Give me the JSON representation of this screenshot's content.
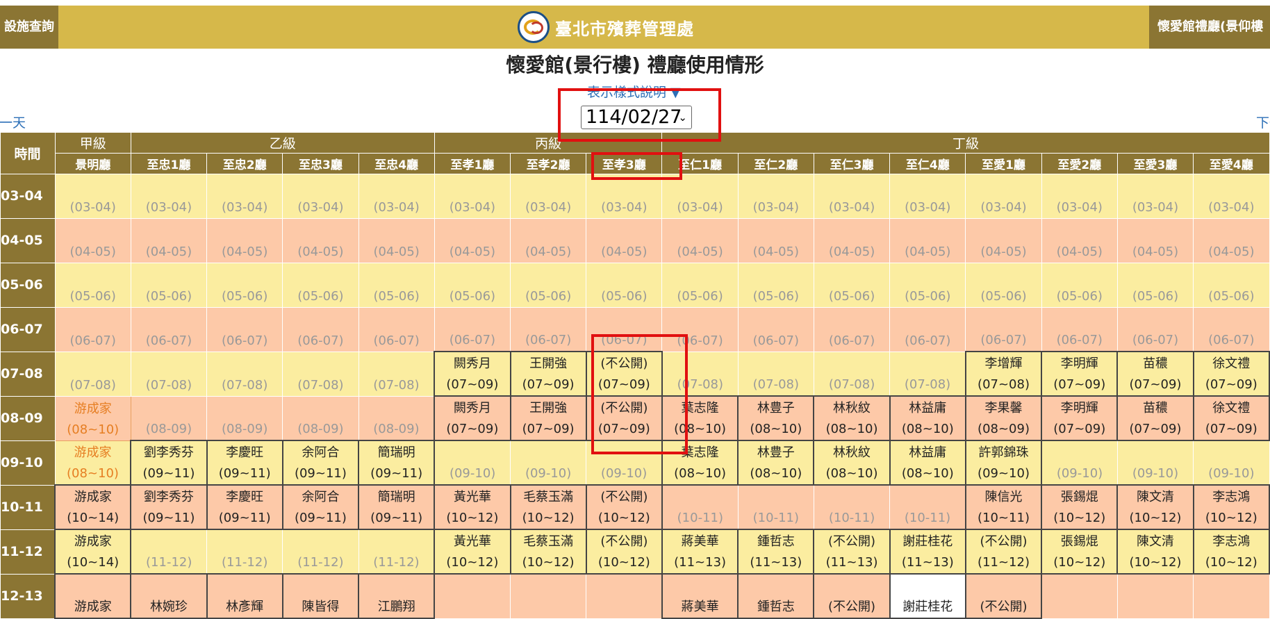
{
  "header": {
    "left_button": "設施查詢",
    "brand_title": "臺北市殯葬管理處",
    "right_button": "懷愛館禮廳(景仰樓"
  },
  "page_title": "懷愛館(景行樓) 禮廳使用情形",
  "legend_link": "表示樣式說明 ▼",
  "date_select": {
    "value": "114/02/27"
  },
  "nav": {
    "prev": "上一天",
    "next": "下一"
  },
  "time_header": "時間",
  "groups": [
    {
      "label": "甲級",
      "span": 1
    },
    {
      "label": "乙級",
      "span": 4
    },
    {
      "label": "丙級",
      "span": 3
    },
    {
      "label": "丁級",
      "span": 8
    }
  ],
  "halls": [
    "景明廳",
    "至忠1廳",
    "至忠2廳",
    "至忠3廳",
    "至忠4廳",
    "至孝1廳",
    "至孝2廳",
    "至孝3廳",
    "至仁1廳",
    "至仁2廳",
    "至仁3廳",
    "至仁4廳",
    "至愛1廳",
    "至愛2廳",
    "至愛3廳",
    "至愛4廳"
  ],
  "rows": [
    {
      "time": "03-04",
      "tone": "y",
      "cells": [
        {
          "t": "(03-04)"
        },
        {
          "t": "(03-04)"
        },
        {
          "t": "(03-04)"
        },
        {
          "t": "(03-04)"
        },
        {
          "t": "(03-04)"
        },
        {
          "t": "(03-04)"
        },
        {
          "t": "(03-04)"
        },
        {
          "t": "(03-04)"
        },
        {
          "t": "(03-04)"
        },
        {
          "t": "(03-04)"
        },
        {
          "t": "(03-04)"
        },
        {
          "t": "(03-04)"
        },
        {
          "t": "(03-04)"
        },
        {
          "t": "(03-04)"
        },
        {
          "t": "(03-04)"
        },
        {
          "t": "(03-04)"
        }
      ]
    },
    {
      "time": "04-05",
      "tone": "p",
      "cells": [
        {
          "t": "(04-05)"
        },
        {
          "t": "(04-05)"
        },
        {
          "t": "(04-05)"
        },
        {
          "t": "(04-05)"
        },
        {
          "t": "(04-05)"
        },
        {
          "t": "(04-05)"
        },
        {
          "t": "(04-05)"
        },
        {
          "t": "(04-05)"
        },
        {
          "t": "(04-05)"
        },
        {
          "t": "(04-05)"
        },
        {
          "t": "(04-05)"
        },
        {
          "t": "(04-05)"
        },
        {
          "t": "(04-05)"
        },
        {
          "t": "(04-05)"
        },
        {
          "t": "(04-05)"
        },
        {
          "t": "(04-05)"
        }
      ]
    },
    {
      "time": "05-06",
      "tone": "y",
      "cells": [
        {
          "t": "(05-06)"
        },
        {
          "t": "(05-06)"
        },
        {
          "t": "(05-06)"
        },
        {
          "t": "(05-06)"
        },
        {
          "t": "(05-06)"
        },
        {
          "t": "(05-06)"
        },
        {
          "t": "(05-06)"
        },
        {
          "t": "(05-06)"
        },
        {
          "t": "(05-06)"
        },
        {
          "t": "(05-06)"
        },
        {
          "t": "(05-06)"
        },
        {
          "t": "(05-06)"
        },
        {
          "t": "(05-06)"
        },
        {
          "t": "(05-06)"
        },
        {
          "t": "(05-06)"
        },
        {
          "t": "(05-06)"
        }
      ]
    },
    {
      "time": "06-07",
      "tone": "p",
      "cells": [
        {
          "t": "(06-07)"
        },
        {
          "t": "(06-07)"
        },
        {
          "t": "(06-07)"
        },
        {
          "t": "(06-07)"
        },
        {
          "t": "(06-07)"
        },
        {
          "t": "(06-07)"
        },
        {
          "t": "(06-07)"
        },
        {
          "t": "(06-07)"
        },
        {
          "t": "(06-07)"
        },
        {
          "t": "(06-07)"
        },
        {
          "t": "(06-07)"
        },
        {
          "t": "(06-07)"
        },
        {
          "t": "(06-07)"
        },
        {
          "t": "(06-07)"
        },
        {
          "t": "(06-07)"
        },
        {
          "t": "(06-07)"
        }
      ]
    },
    {
      "time": "07-08",
      "tone": "y",
      "cells": [
        {
          "t": "(07-08)"
        },
        {
          "t": "(07-08)"
        },
        {
          "t": "(07-08)"
        },
        {
          "t": "(07-08)"
        },
        {
          "t": "(07-08)"
        },
        {
          "n": "闕秀月",
          "t": "(07~09)"
        },
        {
          "n": "王開強",
          "t": "(07~09)"
        },
        {
          "n": "(不公開)",
          "t": "(07~09)"
        },
        {
          "t": "(07-08)"
        },
        {
          "t": "(07-08)"
        },
        {
          "t": "(07-08)"
        },
        {
          "t": "(07-08)"
        },
        {
          "n": "李增輝",
          "t": "(07~08)"
        },
        {
          "n": "李明輝",
          "t": "(07~09)"
        },
        {
          "n": "苗穠",
          "t": "(07~09)"
        },
        {
          "n": "徐文禮",
          "t": "(07~09)"
        }
      ]
    },
    {
      "time": "08-09",
      "tone": "p",
      "cells": [
        {
          "n": "游成家",
          "t": "(08~10)",
          "orange": true
        },
        {
          "t": "(08-09)"
        },
        {
          "t": "(08-09)"
        },
        {
          "t": "(08-09)"
        },
        {
          "t": "(08-09)"
        },
        {
          "n": "闕秀月",
          "t": "(07~09)"
        },
        {
          "n": "王開強",
          "t": "(07~09)"
        },
        {
          "n": "(不公開)",
          "t": "(07~09)"
        },
        {
          "n": "葉志隆",
          "t": "(08~10)"
        },
        {
          "n": "林豊子",
          "t": "(08~10)"
        },
        {
          "n": "林秋紋",
          "t": "(08~10)"
        },
        {
          "n": "林益庸",
          "t": "(08~10)"
        },
        {
          "n": "李果馨",
          "t": "(08~09)"
        },
        {
          "n": "李明輝",
          "t": "(07~09)"
        },
        {
          "n": "苗穠",
          "t": "(07~09)"
        },
        {
          "n": "徐文禮",
          "t": "(07~09)"
        }
      ]
    },
    {
      "time": "09-10",
      "tone": "y",
      "cells": [
        {
          "n": "游成家",
          "t": "(08~10)",
          "orange": true
        },
        {
          "n": "劉李秀芬",
          "t": "(09~11)"
        },
        {
          "n": "李慶旺",
          "t": "(09~11)"
        },
        {
          "n": "余阿合",
          "t": "(09~11)"
        },
        {
          "n": "簡瑞明",
          "t": "(09~11)"
        },
        {
          "t": "(09-10)"
        },
        {
          "t": "(09-10)"
        },
        {
          "t": "(09-10)"
        },
        {
          "n": "葉志隆",
          "t": "(08~10)"
        },
        {
          "n": "林豊子",
          "t": "(08~10)"
        },
        {
          "n": "林秋紋",
          "t": "(08~10)"
        },
        {
          "n": "林益庸",
          "t": "(08~10)"
        },
        {
          "n": "許郭錦珠",
          "t": "(09~10)"
        },
        {
          "t": "(09-10)"
        },
        {
          "t": "(09-10)"
        },
        {
          "t": "(09-10)"
        }
      ]
    },
    {
      "time": "10-11",
      "tone": "p",
      "cells": [
        {
          "n": "游成家",
          "t": "(10~14)"
        },
        {
          "n": "劉李秀芬",
          "t": "(09~11)"
        },
        {
          "n": "李慶旺",
          "t": "(09~11)"
        },
        {
          "n": "余阿合",
          "t": "(09~11)"
        },
        {
          "n": "簡瑞明",
          "t": "(09~11)"
        },
        {
          "n": "黃光華",
          "t": "(10~12)"
        },
        {
          "n": "毛蔡玉滿",
          "t": "(10~12)"
        },
        {
          "n": "(不公開)",
          "t": "(10~12)"
        },
        {
          "t": "(10-11)"
        },
        {
          "t": "(10-11)"
        },
        {
          "t": "(10-11)"
        },
        {
          "t": "(10-11)"
        },
        {
          "n": "陳信光",
          "t": "(10~11)"
        },
        {
          "n": "張錫焜",
          "t": "(10~12)"
        },
        {
          "n": "陳文清",
          "t": "(10~12)"
        },
        {
          "n": "李志鴻",
          "t": "(10~12)"
        }
      ]
    },
    {
      "time": "11-12",
      "tone": "y",
      "cells": [
        {
          "n": "游成家",
          "t": "(10~14)"
        },
        {
          "t": "(11-12)"
        },
        {
          "t": "(11-12)"
        },
        {
          "t": "(11-12)"
        },
        {
          "t": "(11-12)"
        },
        {
          "n": "黃光華",
          "t": "(10~12)"
        },
        {
          "n": "毛蔡玉滿",
          "t": "(10~12)"
        },
        {
          "n": "(不公開)",
          "t": "(10~12)"
        },
        {
          "n": "蔣美華",
          "t": "(11~13)"
        },
        {
          "n": "鍾哲志",
          "t": "(11~13)"
        },
        {
          "n": "(不公開)",
          "t": "(11~13)"
        },
        {
          "n": "謝莊桂花",
          "t": "(11~13)"
        },
        {
          "n": "(不公開)",
          "t": "(11~12)"
        },
        {
          "n": "張錫焜",
          "t": "(10~12)"
        },
        {
          "n": "陳文清",
          "t": "(10~12)"
        },
        {
          "n": "李志鴻",
          "t": "(10~12)"
        }
      ]
    },
    {
      "time": "12-13",
      "tone": "p",
      "cells": [
        {
          "n": "游成家",
          "t": ""
        },
        {
          "n": "林婉珍",
          "t": ""
        },
        {
          "n": "林彥輝",
          "t": ""
        },
        {
          "n": "陳皆得",
          "t": ""
        },
        {
          "n": "江鵬翔",
          "t": ""
        },
        {
          "t": ""
        },
        {
          "t": ""
        },
        {
          "t": ""
        },
        {
          "n": "蔣美華",
          "t": ""
        },
        {
          "n": "鍾哲志",
          "t": ""
        },
        {
          "n": "(不公開)",
          "t": ""
        },
        {
          "n": "謝莊桂花",
          "t": "",
          "white": true
        },
        {
          "n": "(不公開)",
          "t": ""
        },
        {
          "t": ""
        },
        {
          "t": ""
        },
        {
          "t": ""
        }
      ]
    }
  ]
}
